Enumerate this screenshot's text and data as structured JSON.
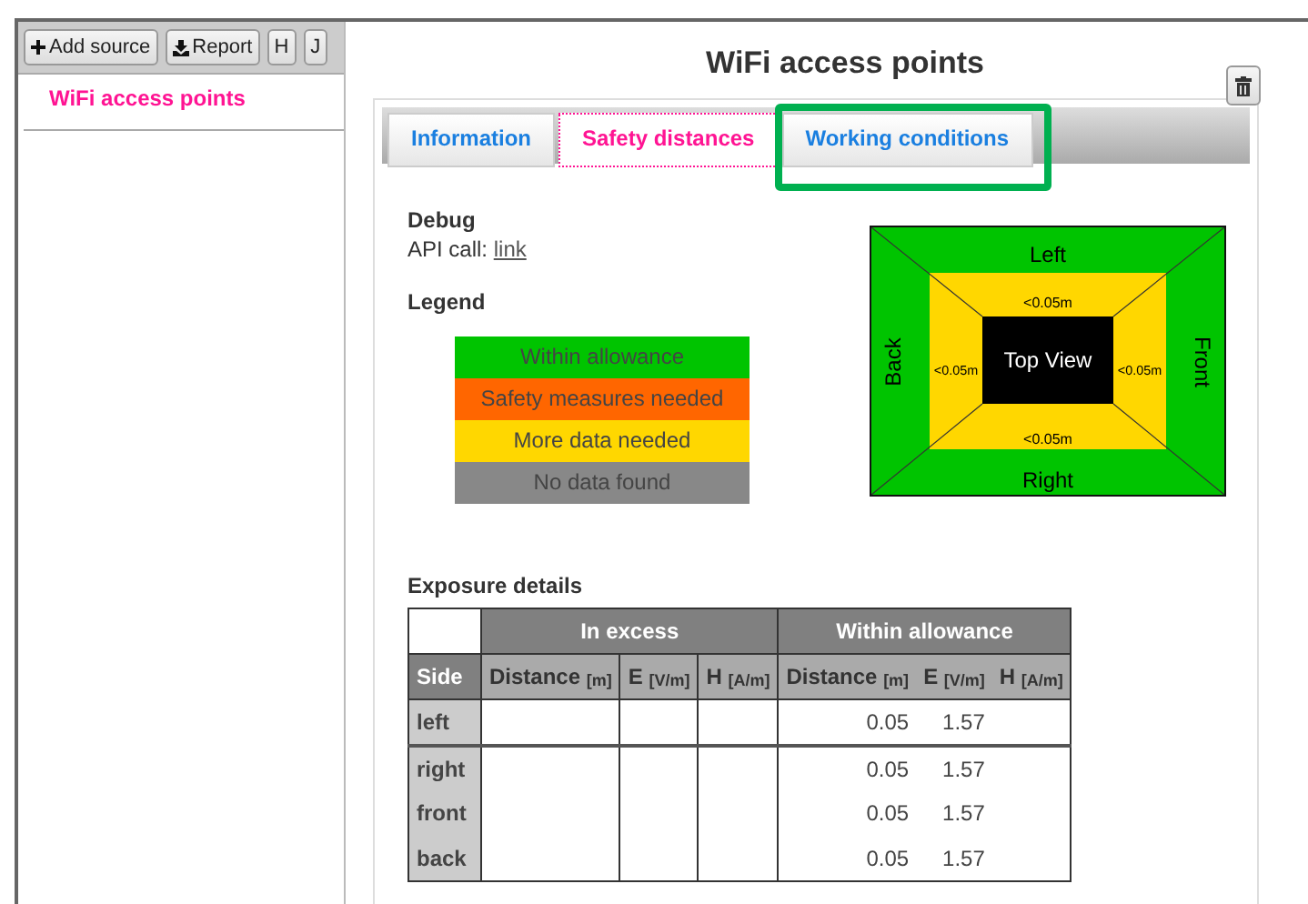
{
  "toolbar": [
    {
      "label": "Add source",
      "kind": "add"
    },
    {
      "label": "Report",
      "kind": "report"
    },
    {
      "label": "H",
      "kind": "plain"
    },
    {
      "label": "J",
      "kind": "plain"
    }
  ],
  "sidebar": {
    "items": [
      {
        "label": "WiFi access points",
        "selected": true
      }
    ]
  },
  "title": "WiFi access points",
  "tabs": [
    {
      "label": "Information",
      "selected": false,
      "highlighted": false
    },
    {
      "label": "Safety distances",
      "selected": true,
      "highlighted": false
    },
    {
      "label": "Working conditions",
      "selected": false,
      "highlighted": true
    }
  ],
  "debug": {
    "heading": "Debug",
    "label": "API call:",
    "link": "link"
  },
  "legend": {
    "heading": "Legend",
    "items": [
      {
        "label": "Within allowance",
        "color": "#00c400"
      },
      {
        "label": "Safety measures needed",
        "color": "#ff6600"
      },
      {
        "label": "More data needed",
        "color": "#ffd700"
      },
      {
        "label": "No data found",
        "color": "#888888"
      }
    ]
  },
  "diagram": {
    "center": "Top View",
    "sides": [
      {
        "label": "Left",
        "distance": "<0.05m"
      },
      {
        "label": "Right",
        "distance": "<0.05m"
      },
      {
        "label": "Back",
        "distance": "<0.05m"
      },
      {
        "label": "Front",
        "distance": "<0.05m"
      }
    ]
  },
  "exposure": {
    "heading": "Exposure details",
    "groups": [
      "In excess",
      "Within allowance"
    ],
    "columns": [
      "Side",
      "Distance $_{[m]}$",
      "E $_{[V/m]}$",
      "H $_{[A/m]}$",
      "Distance $_{[m]}$",
      "E $_{[V/m]}$",
      "H $_{[A/m]}$"
    ],
    "rows": [
      {
        "cells": [
          "left",
          "",
          "",
          "",
          "0.05",
          "1.57",
          ""
        ]
      },
      {
        "cells": [
          "right",
          "",
          "",
          "",
          "0.05",
          "1.57",
          ""
        ]
      },
      {
        "cells": [
          "front",
          "",
          "",
          "",
          "0.05",
          "1.57",
          ""
        ]
      },
      {
        "cells": [
          "back",
          "",
          "",
          "",
          "0.05",
          "1.57",
          ""
        ]
      }
    ]
  }
}
